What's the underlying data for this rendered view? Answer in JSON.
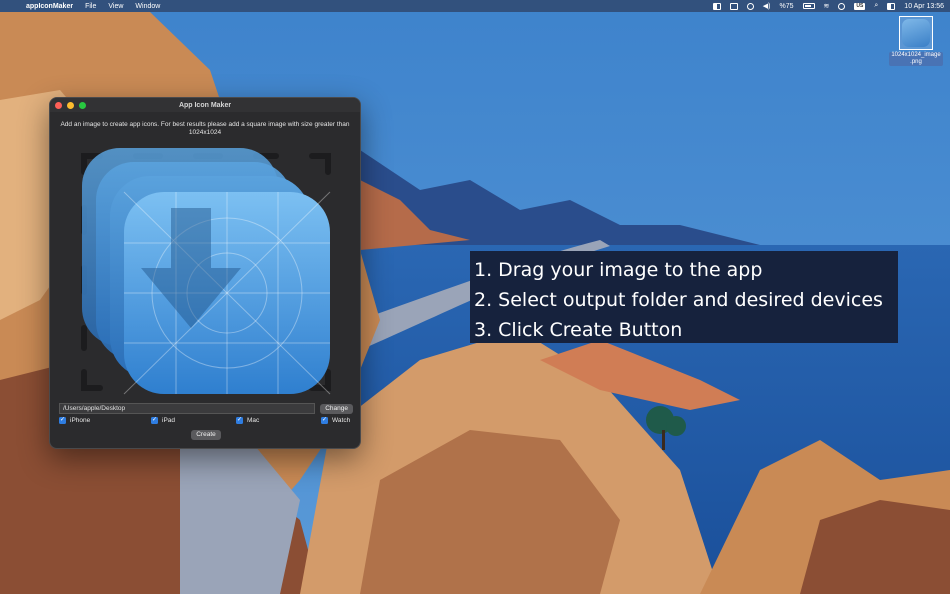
{
  "menubar": {
    "apple_symbol": "",
    "app_name": "appIconMaker",
    "menus": [
      "File",
      "View",
      "Window"
    ],
    "battery_percent": "%75",
    "input_source": "US",
    "clock": "10 Apr  13:56"
  },
  "desktop": {
    "file_name_line1": "1024x1024_image",
    "file_name_line2": ".png"
  },
  "window": {
    "title": "App Icon Maker",
    "instructions": "Add an image to create app icons. For best results please add a square image with size greater than 1024x1024",
    "output_path": "/Users/apple/Desktop",
    "change_label": "Change",
    "create_label": "Create",
    "devices": [
      {
        "label": "iPhone",
        "checked": true
      },
      {
        "label": "iPad",
        "checked": true
      },
      {
        "label": "Mac",
        "checked": true
      },
      {
        "label": "Watch",
        "checked": true
      }
    ],
    "checkmark": "✓"
  },
  "overlay": {
    "steps": [
      "1. Drag your image to the app",
      "2. Select output folder and desired devices",
      "3. Click Create Button"
    ]
  },
  "colors": {
    "sky": "#3e83cc",
    "sea": "#1f5aa8",
    "cliff": "#c98a55",
    "window_bg": "#2b2b2d",
    "accent": "#2f7de1",
    "overlay_bg": "#16223d"
  }
}
